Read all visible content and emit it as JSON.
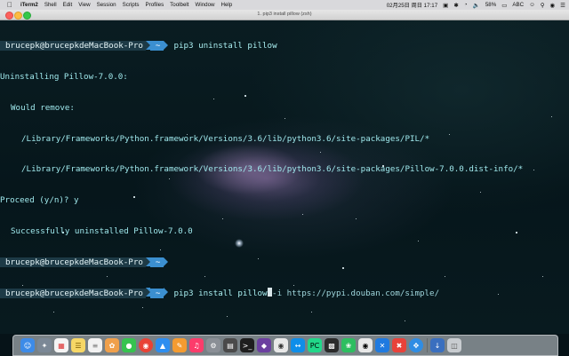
{
  "menubar": {
    "app_name": "iTerm2",
    "menus": [
      "Shell",
      "Edit",
      "View",
      "Session",
      "Scripts",
      "Profiles",
      "Toolbelt",
      "Window",
      "Help"
    ],
    "clock": "02月25日 周日 17:17",
    "battery": "58%",
    "input_source": "ABC"
  },
  "window": {
    "title": "1. pip3 install pillow (zsh)"
  },
  "terminal": {
    "prompt_user": "brucepk@brucepkdeMacBook-Pro",
    "prompt_dir": "~",
    "cmd1": "pip3 uninstall pillow",
    "out1": "Uninstalling Pillow-7.0.0:",
    "out2": "Would remove:",
    "out3": "/Library/Frameworks/Python.framework/Versions/3.6/lib/python3.6/site-packages/PIL/*",
    "out4": "/Library/Frameworks/Python.framework/Versions/3.6/lib/python3.6/site-packages/Pillow-7.0.0.dist-info/*",
    "out5": "Proceed (y/n)? y",
    "out6": "Successfully uninstalled Pillow-7.0.0",
    "cmd3_typed": "pip3 install pillow",
    "cmd3_rest": "-i https://pypi.douban.com/simple/"
  },
  "dock": {
    "icons": [
      "finder-icon",
      "launchpad-icon",
      "calendar-icon",
      "notes-icon",
      "reminders-icon",
      "photos-icon",
      "wechat-icon",
      "chrome-icon",
      "keynote-icon",
      "pages-icon",
      "music-icon",
      "system-preferences-icon",
      "activity-monitor-icon",
      "terminal-icon",
      "iterm-icon",
      "qq-icon",
      "teamviewer-icon",
      "pycharm-icon",
      "console-icon",
      "evernote-icon",
      "penguin-icon",
      "xcode-icon",
      "xmind-icon",
      "safari-icon",
      "trash-icon"
    ],
    "colors": {
      "finder": "#3d8be8",
      "launchpad": "#7b8896",
      "calendar": "#f4f4f4",
      "notes": "#f6d766",
      "photos": "#f0a04b",
      "wechat": "#36c34f",
      "chrome": "#e94235",
      "keynote": "#2d8ef0",
      "music": "#fc3c6b",
      "terminal": "#1e1e1e",
      "pycharm": "#21d789",
      "safari": "#2f8de4"
    }
  }
}
